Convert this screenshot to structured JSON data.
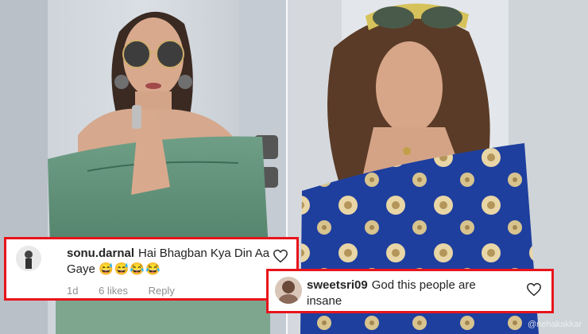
{
  "comments": [
    {
      "username": "sonu.darnal",
      "text": "Hai Bhagban Kya Din Aa Gaye",
      "emoji": "😅😅😂😂",
      "time": "1d",
      "likes": "6 likes",
      "reply": "Reply"
    },
    {
      "username": "sweetsri09",
      "text": "God this people are insane"
    }
  ],
  "watermark": "@nehakakkar",
  "colors": {
    "highlight_border": "#e8141b",
    "pillow_green": "#5f8f77",
    "fabric_blue": "#1e3f9e"
  }
}
